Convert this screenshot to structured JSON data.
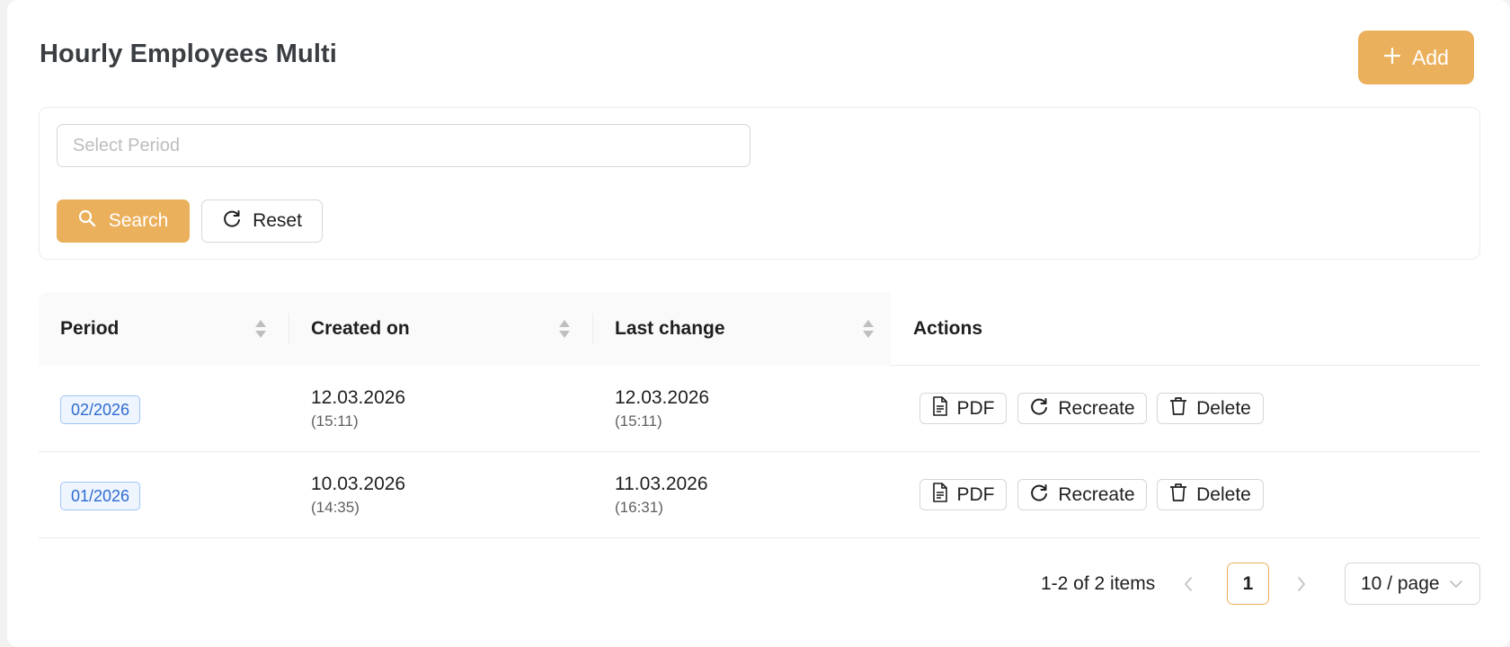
{
  "header": {
    "title": "Hourly Employees Multi",
    "add_label": "Add"
  },
  "filter": {
    "period_placeholder": "Select Period",
    "period_value": "",
    "search_label": "Search",
    "reset_label": "Reset"
  },
  "table": {
    "columns": {
      "period": "Period",
      "created_on": "Created on",
      "last_change": "Last change",
      "actions": "Actions"
    },
    "rows": [
      {
        "period": "02/2026",
        "created_date": "12.03.2026",
        "created_time": "(15:11)",
        "changed_date": "12.03.2026",
        "changed_time": "(15:11)"
      },
      {
        "period": "01/2026",
        "created_date": "10.03.2026",
        "created_time": "(14:35)",
        "changed_date": "11.03.2026",
        "changed_time": "(16:31)"
      }
    ],
    "action_labels": {
      "pdf": "PDF",
      "recreate": "Recreate",
      "delete": "Delete"
    }
  },
  "pagination": {
    "total_text": "1-2 of 2 items",
    "current_page": "1",
    "page_size": "10 / page"
  },
  "colors": {
    "accent": "#ebb05c",
    "tag_text": "#2f6bd1",
    "tag_bg": "#eef5ff",
    "tag_border": "#9fc4f5"
  }
}
